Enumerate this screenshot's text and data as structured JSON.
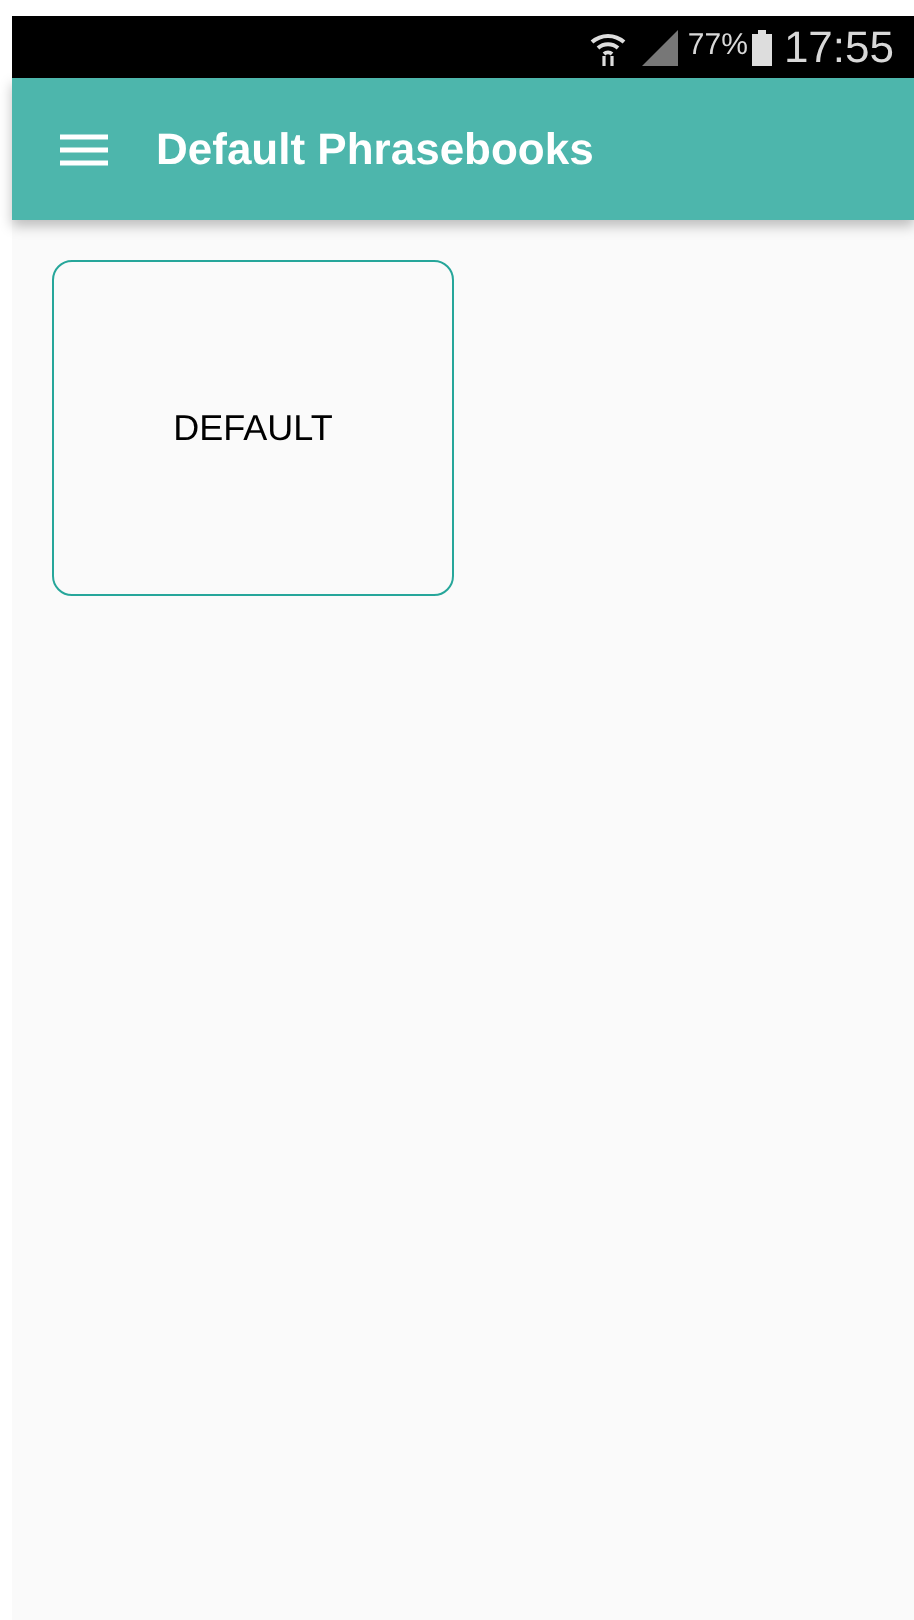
{
  "status_bar": {
    "battery": "77%",
    "time": "17:55"
  },
  "app_bar": {
    "title": "Default Phrasebooks"
  },
  "phrasebooks": [
    {
      "label": "DEFAULT"
    }
  ]
}
